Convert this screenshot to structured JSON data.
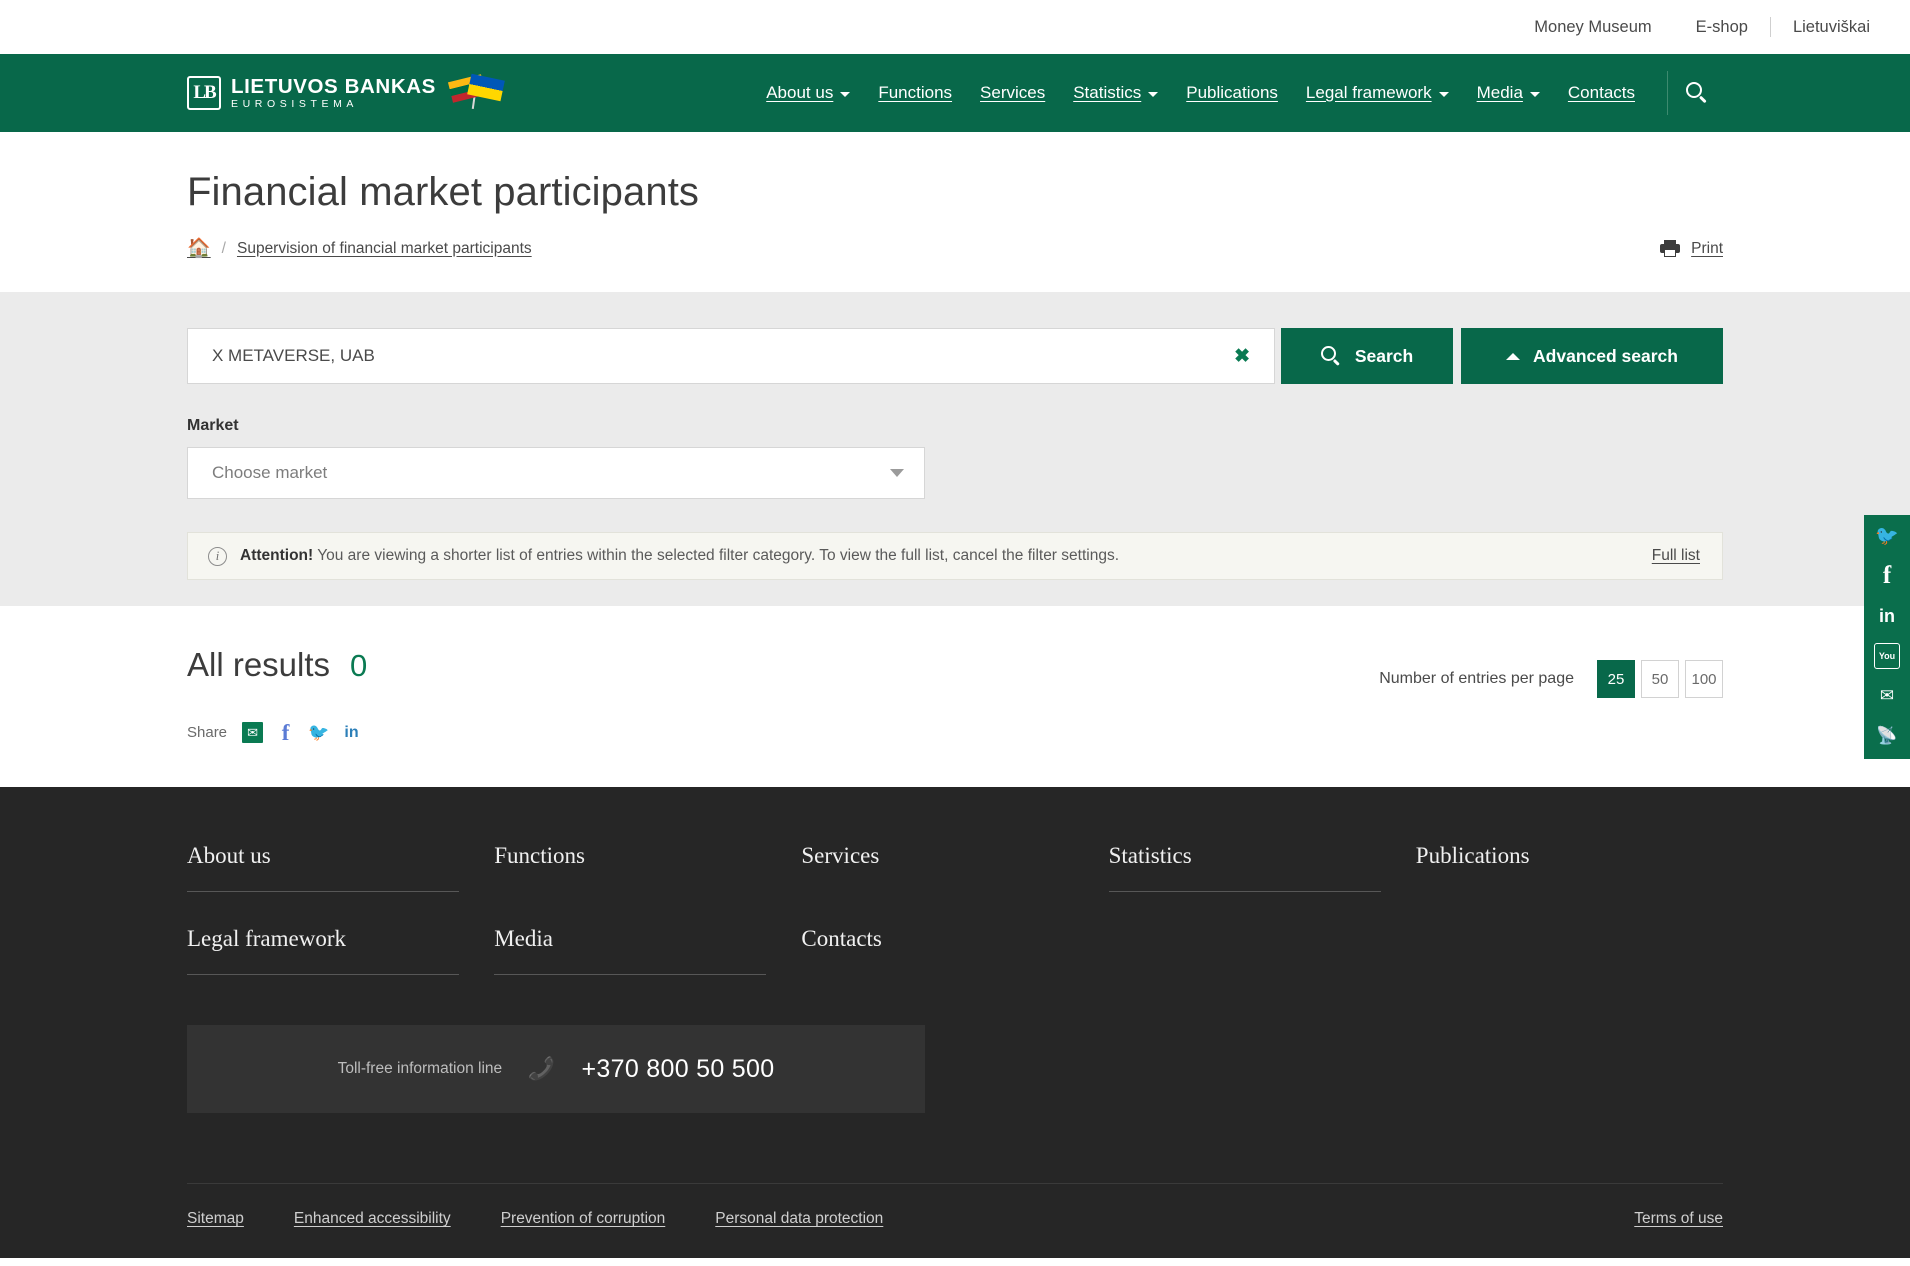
{
  "topbar": {
    "links": [
      {
        "label": "Money Museum"
      },
      {
        "label": "E-shop"
      },
      {
        "label": "Lietuviškai"
      }
    ]
  },
  "header": {
    "logo": {
      "mark": "LB",
      "line1": "LIETUVOS BANKAS",
      "line2": "EUROSISTEMA"
    },
    "nav": [
      {
        "label": "About us",
        "has_dropdown": true
      },
      {
        "label": "Functions",
        "has_dropdown": false
      },
      {
        "label": "Services",
        "has_dropdown": false
      },
      {
        "label": "Statistics",
        "has_dropdown": true
      },
      {
        "label": "Publications",
        "has_dropdown": false
      },
      {
        "label": "Legal framework",
        "has_dropdown": true
      },
      {
        "label": "Media",
        "has_dropdown": true
      },
      {
        "label": "Contacts",
        "has_dropdown": false
      }
    ],
    "search_icon": "search-icon"
  },
  "page": {
    "title": "Financial market participants",
    "breadcrumb": {
      "home_icon": "home-icon",
      "separator": "/",
      "current": "Supervision of financial market participants"
    },
    "print": {
      "label": "Print",
      "icon": "printer-icon"
    }
  },
  "search": {
    "value": "X METAVERSE, UAB",
    "placeholder": "",
    "clear_icon": "✖",
    "search_button": "Search",
    "advanced_button": "Advanced search"
  },
  "market": {
    "label": "Market",
    "placeholder": "Choose market"
  },
  "notice": {
    "icon": "info-icon",
    "bold": "Attention!",
    "text": "You are viewing a shorter list of entries within the selected filter category. To view the full list, cancel the filter settings.",
    "link": "Full list"
  },
  "results": {
    "title": "All results",
    "count": "0",
    "share_label": "Share",
    "share_icons": [
      "email-icon",
      "facebook-icon",
      "twitter-icon",
      "linkedin-icon"
    ],
    "perpage_label": "Number of entries per page",
    "perpage_options": [
      {
        "value": "25",
        "active": true
      },
      {
        "value": "50",
        "active": false
      },
      {
        "value": "100",
        "active": false
      }
    ]
  },
  "socialbar": [
    "twitter-icon",
    "facebook-icon",
    "linkedin-icon",
    "youtube-icon",
    "email-icon",
    "rss-icon"
  ],
  "footer": {
    "columns": [
      {
        "label": "About us",
        "underlined": true
      },
      {
        "label": "Functions",
        "underlined": false
      },
      {
        "label": "Services",
        "underlined": false
      },
      {
        "label": "Statistics",
        "underlined": true
      },
      {
        "label": "Publications",
        "underlined": false
      },
      {
        "label": "Legal framework",
        "underlined": true
      },
      {
        "label": "Media",
        "underlined": true
      },
      {
        "label": "Contacts",
        "underlined": false
      }
    ],
    "phone": {
      "label": "Toll-free information line",
      "icon": "phone-icon",
      "number": "+370 800 50 500"
    },
    "bottom_links": [
      {
        "label": "Sitemap"
      },
      {
        "label": "Enhanced accessibility"
      },
      {
        "label": "Prevention of corruption"
      },
      {
        "label": "Personal data protection"
      }
    ],
    "terms": "Terms of use"
  },
  "colors": {
    "brand_green": "#08684A",
    "accent_green": "#0A7A52",
    "filter_bg": "#EBEBEB",
    "notice_bg": "#F6F6F1",
    "footer_bg": "#262626"
  }
}
